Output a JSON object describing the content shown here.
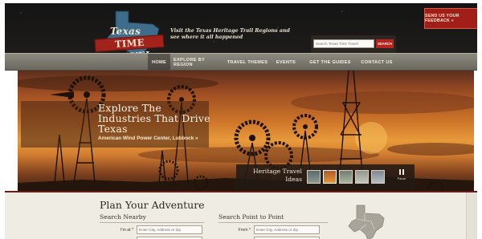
{
  "header": {
    "logo_top": "Texas",
    "logo_main": "TIME TRAVEL",
    "tagline": "Visit the Texas Heritage Trail Regions and see where it all happened",
    "search_placeholder": "Search Texas Time Travel",
    "search_button": "SEARCH",
    "feedback_button": "SEND US YOUR FEEDBACK »"
  },
  "nav": {
    "items": [
      {
        "label": "HOME",
        "active": true
      },
      {
        "label": "EXPLORE BY REGION",
        "active": false
      },
      {
        "label": "TRAVEL THEMES",
        "active": false
      },
      {
        "label": "EVENTS",
        "active": false
      },
      {
        "label": "GET THE GUIDES",
        "active": false
      },
      {
        "label": "CONTACT US",
        "active": false
      }
    ]
  },
  "hero": {
    "title": "Explore The Industries That Drive Texas",
    "credit": "American Wind Power Center, Lubbock »",
    "thumb_label": "Heritage Travel Ideas",
    "pause_label": "Pause",
    "selected_thumb": 2
  },
  "plan": {
    "title": "Plan Your Adventure",
    "nearby": {
      "title": "Search Nearby",
      "field_label": "I'm at *",
      "field_placeholder": "Enter City, Address or Zip"
    },
    "point": {
      "title": "Search Point to Point",
      "field_label": "From *",
      "field_placeholder": "Enter City, Address or Zip"
    }
  },
  "colors": {
    "accent_red": "#a2221c",
    "nav_gray": "#7c796f",
    "header_dark": "#1a1918"
  }
}
